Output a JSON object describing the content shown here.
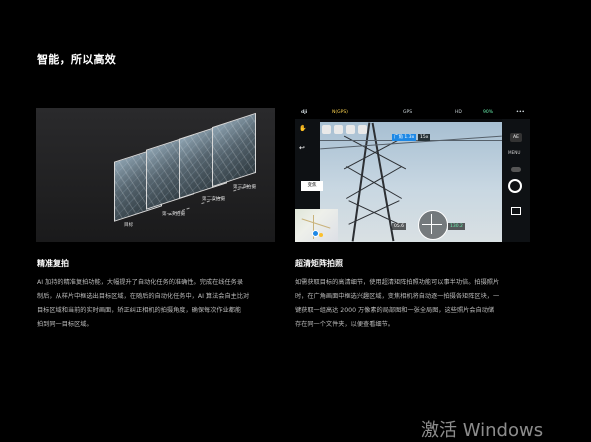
{
  "section": {
    "title": "智能，所以高效"
  },
  "left_image": {
    "frame_labels": [
      "第三次拍摄",
      "第二次拍摄",
      "第一次拍摄",
      "目标"
    ]
  },
  "right_image": {
    "topbar": {
      "brand": "dji",
      "mode": "N(GPS)",
      "gps": "GPS",
      "battery": "90%",
      "hd": "HD"
    },
    "chips": {
      "side_label": "变焦",
      "zoom_label": "广角 1.3x",
      "aperture_label": "15x",
      "speed_value": "05.6",
      "altitude_value": "130.2",
      "menu_label": "MENU",
      "ae_label": "AE"
    }
  },
  "captions": [
    {
      "title": "精准复拍",
      "lines": [
        "AI 加持的精准复拍功能，大幅提升了自动化任务的准确性。完成在线任务录",
        "制后，从样片中框选出目标区域，在随后的自动化任务中，AI 算法会自主比对",
        "目标区域和当前的实时画面，矫正纠正相机的拍摄角度，确保每次作业都能",
        "拍到同一目标区域。"
      ]
    },
    {
      "title": "超清矩阵拍照",
      "lines": [
        "如需获取目标的高清细节，使用超清矩阵拍照功能可以事半功倍。拍摄照片",
        "时，在广角画面中框选兴趣区域，变焦相机将自动逐一拍摄各矩阵区块，一",
        "键获取一组高达 2000 万像素的局部图和一张全局图，这些照片会自动储",
        "存在同一个文件夹，以便查看细节。"
      ]
    }
  ],
  "watermark": "激活 Windows"
}
